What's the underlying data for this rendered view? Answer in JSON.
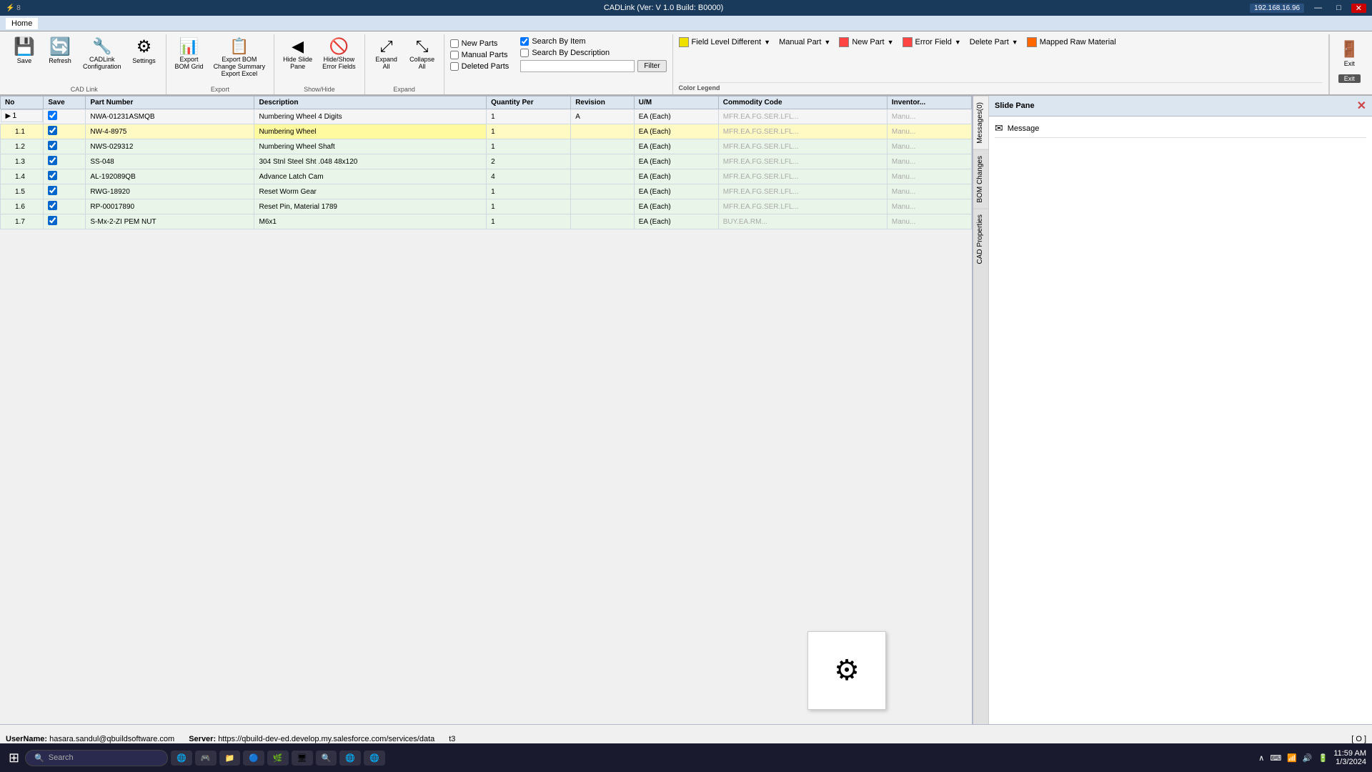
{
  "titlebar": {
    "title": "CADLink (Ver: V 1.0 Build: B0000)",
    "ip": "192.168.16.96",
    "controls": [
      "—",
      "□",
      "✕"
    ]
  },
  "menubar": {
    "items": [
      "Home"
    ]
  },
  "ribbon": {
    "cad_link_group": {
      "label": "CAD Link",
      "buttons": [
        {
          "id": "save",
          "icon": "💾",
          "label": "Save"
        },
        {
          "id": "refresh",
          "icon": "🔄",
          "label": "Refresh"
        },
        {
          "id": "cadlink-config",
          "icon": "🔧",
          "label": "CADLink\nConfiguration"
        },
        {
          "id": "settings",
          "icon": "⚙",
          "label": "Settings"
        }
      ]
    },
    "bom_group": {
      "label": "Export",
      "buttons": [
        {
          "id": "export-bom-grid",
          "icon": "📊",
          "label": "Export\nBOM Grid"
        },
        {
          "id": "export-bom-change",
          "icon": "📋",
          "label": "Export BOM\nChange Summary\nExport Excel"
        }
      ]
    },
    "show_hide_group": {
      "label": "Show/Hide",
      "buttons": [
        {
          "id": "hide-slide-pane",
          "icon": "◀",
          "label": "Hide Slide\nPane"
        },
        {
          "id": "hide-show-error",
          "icon": "🚫",
          "label": "Hide/Show\nError Fields"
        }
      ]
    },
    "expand_group": {
      "label": "Expand",
      "buttons": [
        {
          "id": "expand-all",
          "icon": "⬆⬇",
          "label": "Expand\nAll"
        },
        {
          "id": "collapse-all",
          "icon": "⬇⬆",
          "label": "Collapse\nAll"
        }
      ]
    },
    "filter_group": {
      "checkboxes": [
        {
          "id": "new-parts",
          "label": "New Parts",
          "checked": false
        },
        {
          "id": "manual-parts",
          "label": "Manual Parts",
          "checked": false
        },
        {
          "id": "deleted-parts",
          "label": "Deleted Parts",
          "checked": false
        }
      ],
      "search_checkboxes": [
        {
          "id": "search-by-item",
          "label": "Search By Item",
          "checked": true
        },
        {
          "id": "search-by-desc",
          "label": "Search By Description",
          "checked": false
        }
      ],
      "filter_label": "Filter",
      "filter_placeholder": ""
    },
    "color_legend": {
      "title": "Color Legend",
      "items": [
        {
          "id": "field-level-diff",
          "label": "Field Level Different",
          "color": "#f0e000",
          "has_dropdown": true
        },
        {
          "id": "manual-part",
          "label": "Manual Part",
          "color": "#ffffff",
          "has_dropdown": true
        },
        {
          "id": "new-part",
          "label": "New Part",
          "color": "#ff4444",
          "has_dropdown": false
        },
        {
          "id": "error-field",
          "label": "Error Field",
          "color": "#ff4444",
          "has_dropdown": true
        },
        {
          "id": "delete-part",
          "label": "Delete Part",
          "color": "#ffffff",
          "has_dropdown": true
        },
        {
          "id": "mapped-raw-material",
          "label": "Mapped Raw Material",
          "color": "#ff6600",
          "has_dropdown": false
        }
      ]
    },
    "exit": {
      "label": "Exit",
      "icon": "🚪"
    }
  },
  "table": {
    "columns": [
      {
        "id": "no",
        "label": "No"
      },
      {
        "id": "save",
        "label": "Save"
      },
      {
        "id": "part-number",
        "label": "Part Number"
      },
      {
        "id": "description",
        "label": "Description"
      },
      {
        "id": "quantity-per",
        "label": "Quantity Per"
      },
      {
        "id": "revision",
        "label": "Revision"
      },
      {
        "id": "uom",
        "label": "U/M"
      },
      {
        "id": "commodity-code",
        "label": "Commodity Code"
      },
      {
        "id": "inventory",
        "label": "Inventor..."
      }
    ],
    "rows": [
      {
        "id": "row-1",
        "no": "1",
        "save": true,
        "part_number": "NWA-01231ASMQB",
        "description": "Numbering Wheel 4 Digits",
        "quantity_per": "1",
        "revision": "A",
        "uom": "EA (Each)",
        "commodity_code": "MFR.EA.FG.SER.LFL...",
        "inventory": "Manu...",
        "level": 1,
        "expanded": true,
        "children": [
          {
            "no": "1.1",
            "save": true,
            "part_number": "NW-4-8975",
            "description": "Numbering Wheel",
            "quantity_per": "1",
            "revision": "",
            "uom": "EA (Each)",
            "commodity_code": "MFR.EA.FG.SER.LFL...",
            "inventory": "Manu...",
            "highlighted": true
          },
          {
            "no": "1.2",
            "save": true,
            "part_number": "NWS-029312",
            "description": "Numbering Wheel Shaft",
            "quantity_per": "1",
            "revision": "",
            "uom": "EA (Each)",
            "commodity_code": "MFR.EA.FG.SER.LFL...",
            "inventory": "Manu..."
          },
          {
            "no": "1.3",
            "save": true,
            "part_number": "SS-048",
            "description": "304 Stnl Steel Sht .048 48x120",
            "quantity_per": "2",
            "revision": "",
            "uom": "EA (Each)",
            "commodity_code": "MFR.EA.FG.SER.LFL...",
            "inventory": "Manu..."
          },
          {
            "no": "1.4",
            "save": true,
            "part_number": "AL-192089QB",
            "description": "Advance Latch Cam",
            "quantity_per": "4",
            "revision": "",
            "uom": "EA (Each)",
            "commodity_code": "MFR.EA.FG.SER.LFL...",
            "inventory": "Manu..."
          },
          {
            "no": "1.5",
            "save": true,
            "part_number": "RWG-18920",
            "description": "Reset Worm Gear",
            "quantity_per": "1",
            "revision": "",
            "uom": "EA (Each)",
            "commodity_code": "MFR.EA.FG.SER.LFL...",
            "inventory": "Manu..."
          },
          {
            "no": "1.6",
            "save": true,
            "part_number": "RP-00017890",
            "description": "Reset Pin, Material 1789",
            "quantity_per": "1",
            "revision": "",
            "uom": "EA (Each)",
            "commodity_code": "MFR.EA.FG.SER.LFL...",
            "inventory": "Manu..."
          },
          {
            "no": "1.7",
            "save": true,
            "part_number": "S-Mx-2-ZI PEM NUT",
            "description": "M6x1",
            "quantity_per": "1",
            "revision": "",
            "uom": "EA (Each)",
            "commodity_code": "BUY.EA.RM...",
            "inventory": "Manu..."
          }
        ]
      }
    ]
  },
  "slide_pane": {
    "title": "Slide Pane",
    "tabs": [
      "Messages(0)",
      "BOM Changes",
      "CAD Properties"
    ],
    "active_tab": "Message",
    "message_label": "Message",
    "message_icon": "✉"
  },
  "status_bar": {
    "username_label": "UserName:",
    "username": "hasara.sandul@qbuildsoftware.com",
    "server_label": "Server:",
    "server_url": "https://qbuild-dev-ed.develop.my.salesforce.com/services/data",
    "t_value": "t3",
    "camera_indicator": "[ O ]"
  },
  "taskbar": {
    "start_icon": "⊞",
    "search_placeholder": "Search",
    "apps": [
      "🌐",
      "🎮",
      "📁",
      "🔵",
      "🌿",
      "🖥",
      "🔍",
      "🌐",
      "🌐"
    ],
    "time": "11:59 AM",
    "date": "1/3/2024"
  }
}
